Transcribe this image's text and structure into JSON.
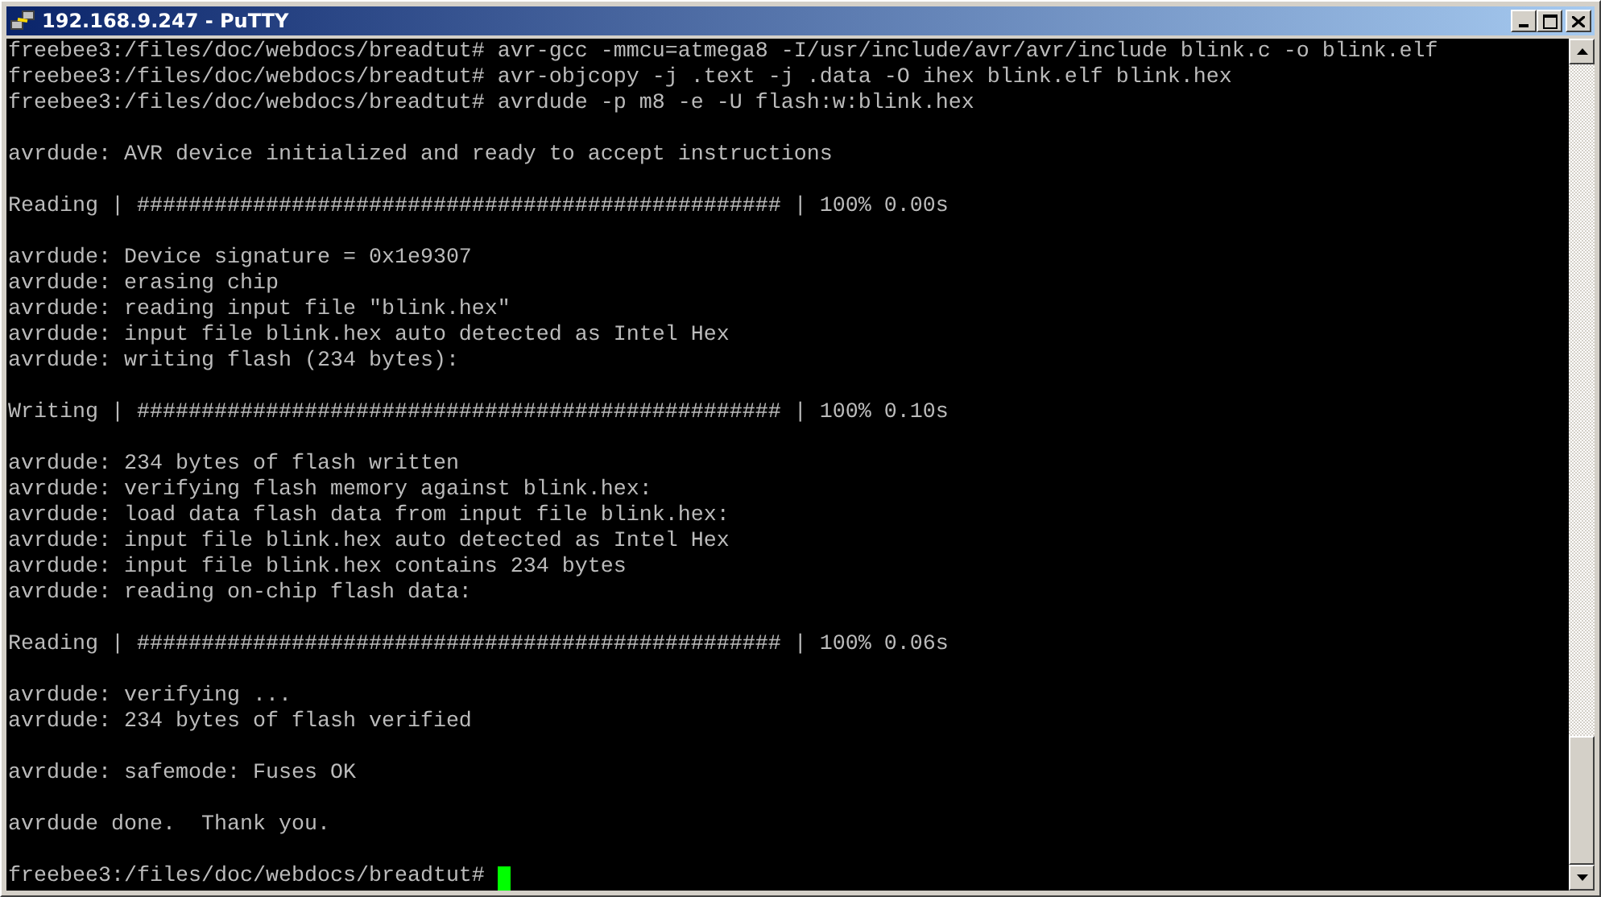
{
  "window": {
    "title": "192.168.9.247 - PuTTY"
  },
  "terminal": {
    "blocks": [
      [
        "freebee3:/files/doc/webdocs/breadtut# avr-gcc -mmcu=atmega8 -I/usr/include/avr/avr/include blink.c -o blink.elf",
        "freebee3:/files/doc/webdocs/breadtut# avr-objcopy -j .text -j .data -O ihex blink.elf blink.hex",
        "freebee3:/files/doc/webdocs/breadtut# avrdude -p m8 -e -U flash:w:blink.hex"
      ],
      [
        "avrdude: AVR device initialized and ready to accept instructions"
      ],
      [
        "Reading | ################################################## | 100% 0.00s"
      ],
      [
        "avrdude: Device signature = 0x1e9307",
        "avrdude: erasing chip",
        "avrdude: reading input file \"blink.hex\"",
        "avrdude: input file blink.hex auto detected as Intel Hex",
        "avrdude: writing flash (234 bytes):"
      ],
      [
        "Writing | ################################################## | 100% 0.10s"
      ],
      [
        "avrdude: 234 bytes of flash written",
        "avrdude: verifying flash memory against blink.hex:",
        "avrdude: load data flash data from input file blink.hex:",
        "avrdude: input file blink.hex auto detected as Intel Hex",
        "avrdude: input file blink.hex contains 234 bytes",
        "avrdude: reading on-chip flash data:"
      ],
      [
        "Reading | ################################################## | 100% 0.06s"
      ],
      [
        "avrdude: verifying ...",
        "avrdude: 234 bytes of flash verified"
      ],
      [
        "avrdude: safemode: Fuses OK"
      ],
      [
        "avrdude done.  Thank you."
      ]
    ],
    "prompt": "freebee3:/files/doc/webdocs/breadtut#"
  }
}
